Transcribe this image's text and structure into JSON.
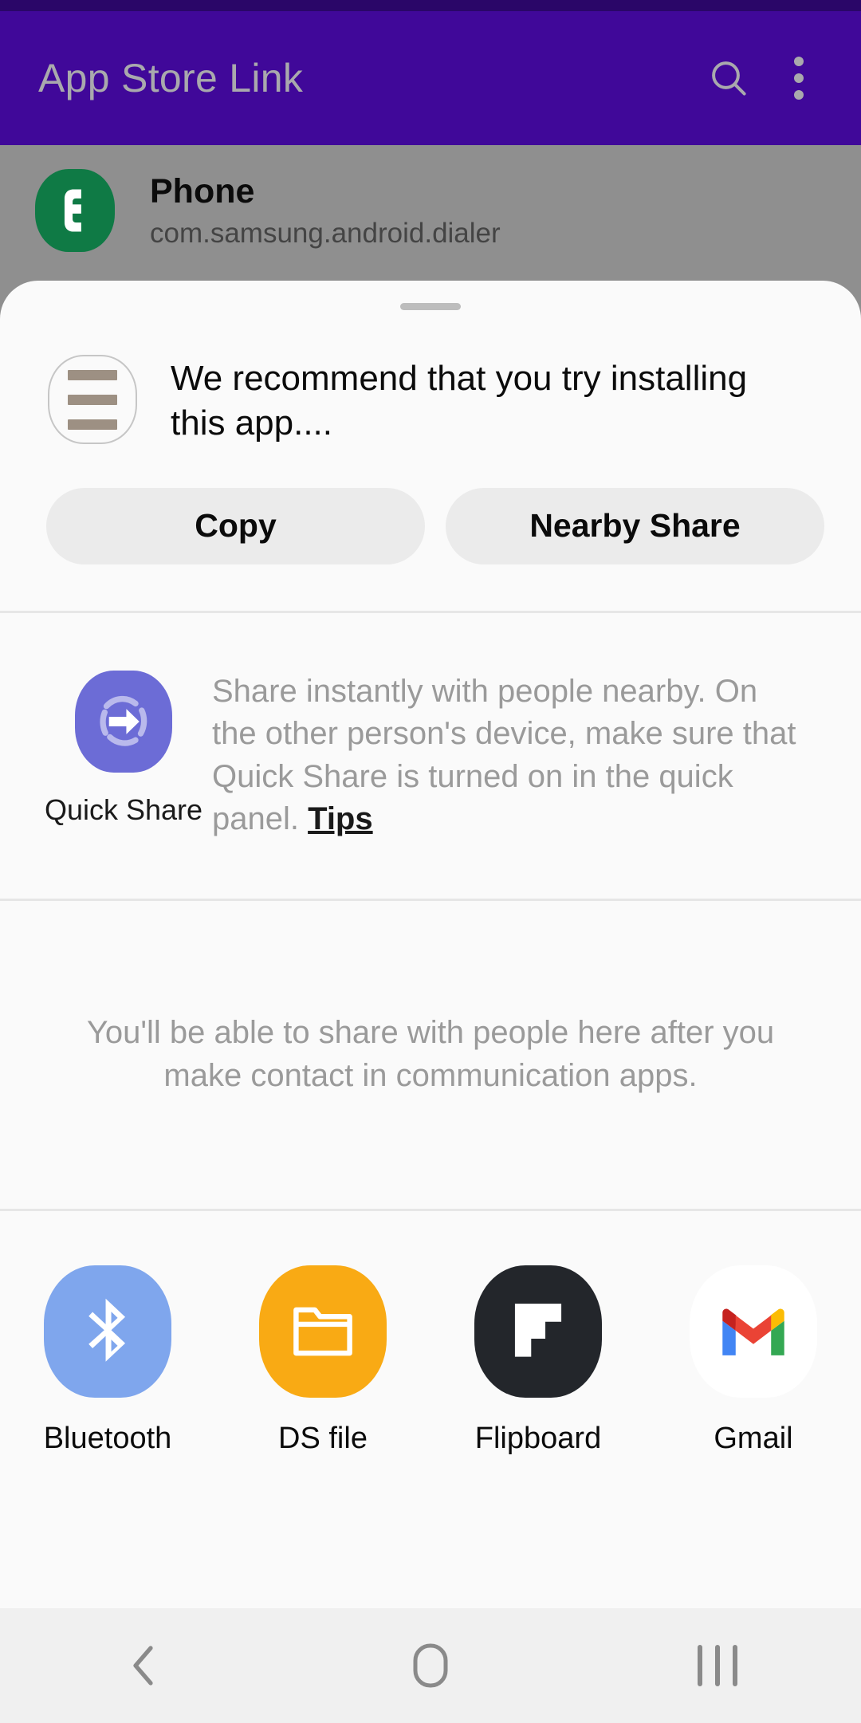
{
  "colors": {
    "appbar_purple": "#400899",
    "statusbar_purple": "#2a0668",
    "appbar_text": "#a9a9ad",
    "sheet_bg": "#fafafa",
    "scrim_gray": "#8f8f8f",
    "pill_bg": "#ebebeb",
    "divider": "#e6e6e6",
    "muted_text": "#9a9a9a",
    "navbar_bg": "#f0f0f0",
    "quick_share_purple": "#6c6cd6",
    "phone_green": "#0f7a45",
    "bluetooth_blue": "#7fa6ed",
    "dsfile_orange": "#f9aa14",
    "flipboard_black": "#23262b",
    "gmail_white": "#ffffff"
  },
  "appbar": {
    "title": "App Store Link",
    "search_icon": "search-icon",
    "overflow_icon": "more-vertical-icon"
  },
  "background_app": {
    "app_name": "Phone",
    "package_name": "com.samsung.android.dialer",
    "icon": "phone-handset-icon"
  },
  "sheet": {
    "grabber": "drag-handle",
    "preview": {
      "icon": "text-lines-icon",
      "text": "We recommend that you try installing this app...."
    },
    "actions": [
      {
        "label": "Copy",
        "name": "copy-button"
      },
      {
        "label": "Nearby Share",
        "name": "nearby-share-button"
      }
    ],
    "quick_share": {
      "icon": "quick-share-icon",
      "label": "Quick Share",
      "description": "Share instantly with people nearby. On the other person's device, make sure that Quick Share is turned on in the quick panel.",
      "link_label": "Tips"
    },
    "empty_state": {
      "message": "You'll be able to share with people here after you make contact in communication apps."
    },
    "app_targets": [
      {
        "label": "Bluetooth",
        "icon": "bluetooth-icon",
        "name": "share-target-bluetooth"
      },
      {
        "label": "DS file",
        "icon": "folder-icon",
        "name": "share-target-ds-file"
      },
      {
        "label": "Flipboard",
        "icon": "flipboard-icon",
        "name": "share-target-flipboard"
      },
      {
        "label": "Gmail",
        "icon": "gmail-icon",
        "name": "share-target-gmail"
      }
    ]
  },
  "navbar": {
    "back": "back-chevron-icon",
    "home": "home-icon",
    "recents": "recents-icon"
  }
}
